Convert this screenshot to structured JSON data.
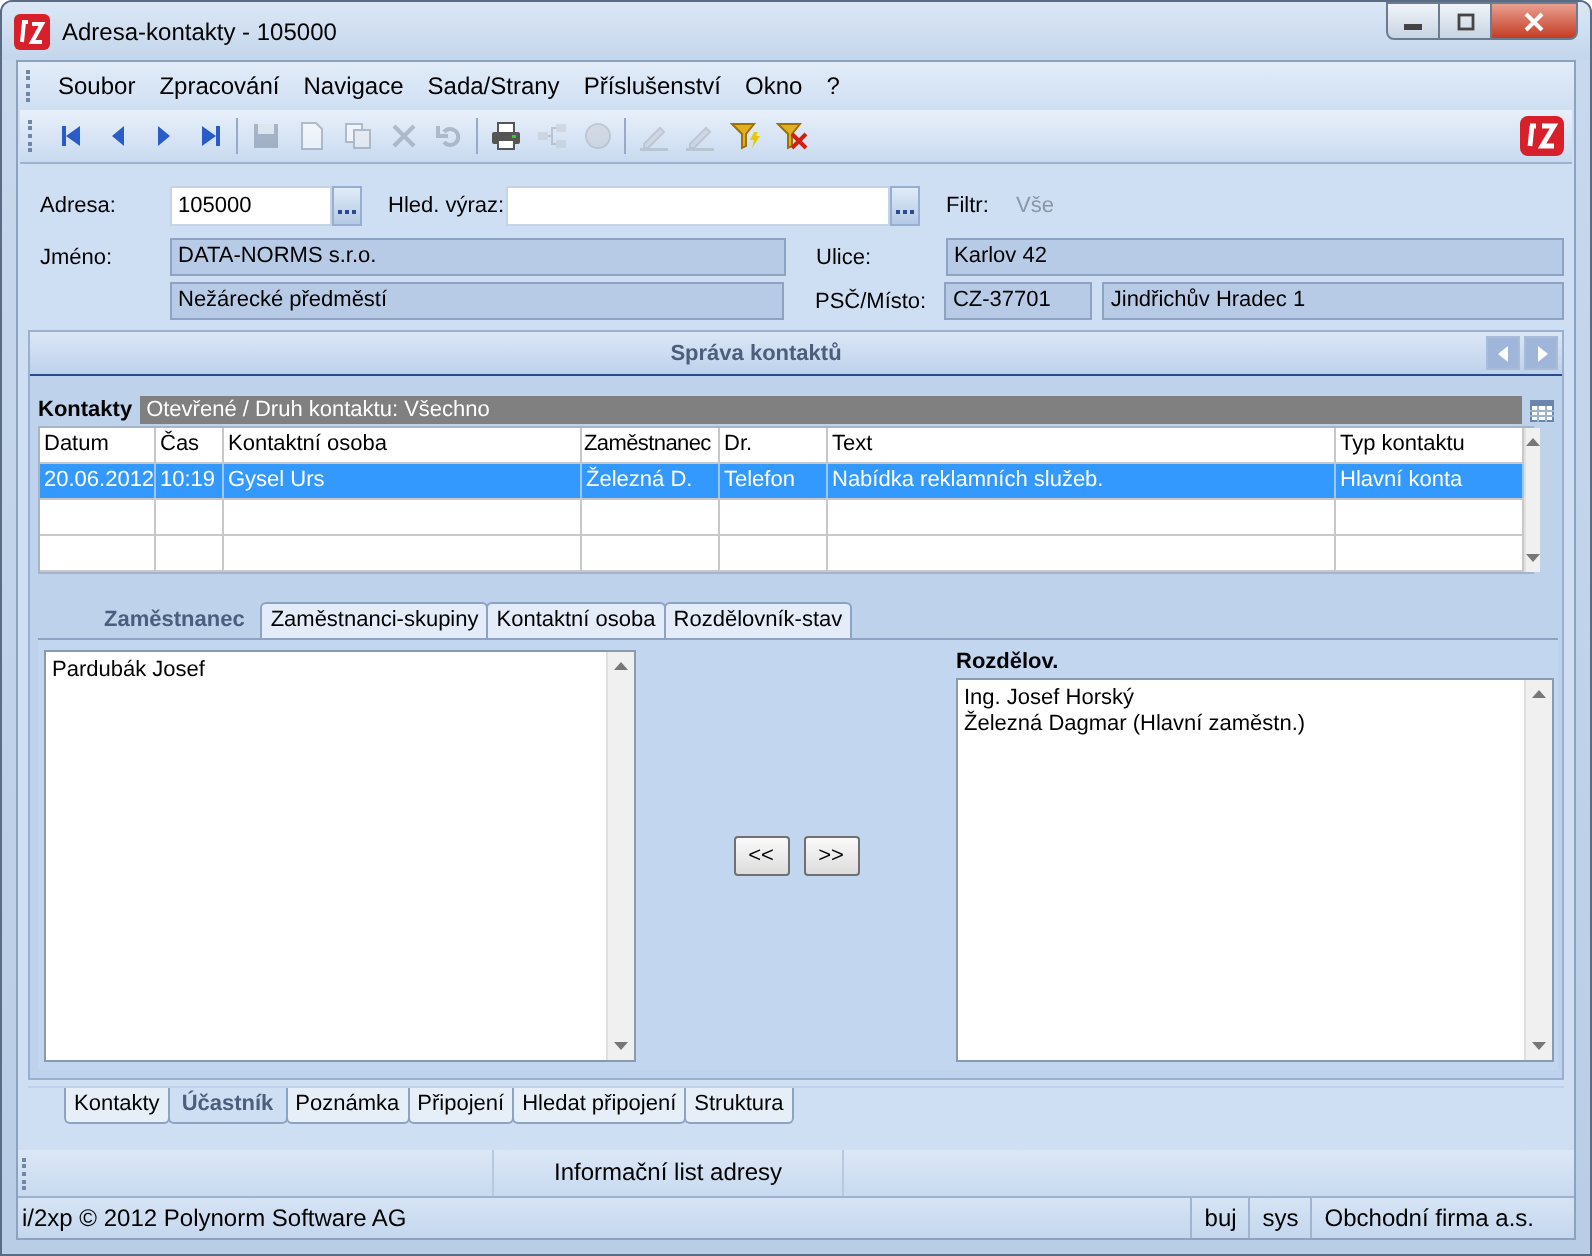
{
  "window": {
    "title": "Adresa-kontakty - 105000"
  },
  "menu": [
    "Soubor",
    "Zpracování",
    "Navigace",
    "Sada/Strany",
    "Příslušenství",
    "Okno",
    "?"
  ],
  "toolbar": {
    "groups": [
      {
        "buttons": [
          {
            "kind": "first",
            "disabled": false
          },
          {
            "kind": "prev",
            "disabled": false
          },
          {
            "kind": "next",
            "disabled": false
          },
          {
            "kind": "last",
            "disabled": false
          }
        ]
      },
      {
        "buttons": [
          {
            "kind": "save",
            "disabled": true
          },
          {
            "kind": "new",
            "disabled": true
          },
          {
            "kind": "copy",
            "disabled": true
          },
          {
            "kind": "delete",
            "disabled": true
          },
          {
            "kind": "undo",
            "disabled": true
          }
        ]
      },
      {
        "buttons": [
          {
            "kind": "print",
            "disabled": false
          },
          {
            "kind": "tree",
            "disabled": true
          },
          {
            "kind": "disc",
            "disabled": true
          }
        ]
      },
      {
        "buttons": [
          {
            "kind": "pen",
            "disabled": true
          },
          {
            "kind": "pen",
            "disabled": true
          },
          {
            "kind": "filter",
            "disabled": false
          },
          {
            "kind": "filter_clear",
            "disabled": false
          }
        ]
      }
    ]
  },
  "form": {
    "address": {
      "label": "Adresa:",
      "value": "105000"
    },
    "search": {
      "label": "Hled. výraz:"
    },
    "filter": {
      "label": "Filtr:",
      "value": "Vše"
    },
    "name": {
      "label": "Jméno:",
      "lines": [
        "DATA-NORMS s.r.o.",
        "Nežárecké předměstí"
      ]
    },
    "street": {
      "label": "Ulice:",
      "value": "Karlov 42"
    },
    "city": {
      "label": "PSČ/Místo:",
      "zip": "CZ-37701",
      "place": "Jindřichův Hradec 1"
    }
  },
  "panel": {
    "title": "Správa kontaktů",
    "contacts_label": "Kontakty",
    "contacts_filter": "Otevřené / Druh kontaktu: Všechno",
    "table": {
      "columns": [
        "Datum",
        "Čas",
        "Kontaktní osoba",
        "Zaměstnanec",
        "Dr.",
        "Text",
        "Typ kontaktu"
      ],
      "rows": [
        {
          "cells": [
            "20.06.2012",
            "10:19",
            "Gysel Urs",
            "Železná D.",
            "Telefon",
            "Nabídka reklamních služeb.",
            "Hlavní konta"
          ],
          "selected": true
        }
      ]
    },
    "tabs": [
      {
        "label": "Zaměstnanec",
        "selected": true
      },
      {
        "label": "Zaměstnanci-skupiny",
        "selected": false
      },
      {
        "label": "Kontaktní osoba",
        "selected": false
      },
      {
        "label": "Rozdělovník-stav",
        "selected": false
      }
    ],
    "available": [
      "Pardubák Josef"
    ],
    "move_buttons": [
      "<<",
      ">>"
    ],
    "distribution": {
      "label": "Rozdělov.",
      "items": [
        "Ing. Josef Horský",
        "Železná Dagmar (Hlavní zaměstn.)"
      ]
    }
  },
  "bottom_tabs": [
    {
      "label": "Kontakty",
      "selected": false
    },
    {
      "label": "Účastník",
      "selected": true
    },
    {
      "label": "Poznámka",
      "selected": false
    },
    {
      "label": "Připojení",
      "selected": false
    },
    {
      "label": "Hledat připojení",
      "selected": false
    },
    {
      "label": "Struktura",
      "selected": false
    }
  ],
  "info_bar": {
    "text": "Informační list adresy"
  },
  "status_bar": {
    "copyright": "i/2xp © 2012 Polynorm Software AG",
    "cells": [
      "buj",
      "sys",
      "Obchodní firma a.s."
    ]
  }
}
